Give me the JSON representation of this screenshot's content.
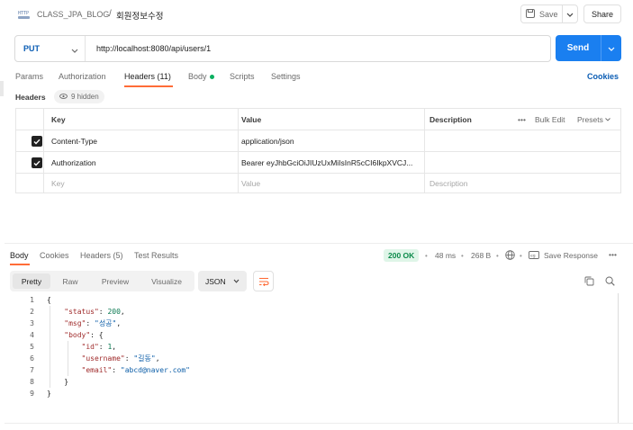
{
  "breadcrumb": {
    "collection": "CLASS_JPA_BLOG",
    "separator": "/",
    "request": "회원정보수정"
  },
  "toolbar": {
    "save_label": "Save",
    "share_label": "Share"
  },
  "request": {
    "method": "PUT",
    "url": "http://localhost:8080/api/users/1",
    "send_label": "Send"
  },
  "req_tabs": [
    {
      "label": "Params"
    },
    {
      "label": "Authorization"
    },
    {
      "label": "Headers (11)"
    },
    {
      "label": "Body"
    },
    {
      "label": "Scripts"
    },
    {
      "label": "Settings"
    }
  ],
  "cookies_label": "Cookies",
  "headers_section": {
    "title": "Headers",
    "hidden_label": "9 hidden",
    "columns": {
      "key": "Key",
      "value": "Value",
      "description": "Description",
      "bulk_edit": "Bulk Edit",
      "presets": "Presets"
    },
    "rows": [
      {
        "checked": true,
        "key": "Content-Type",
        "value": "application/json",
        "description": ""
      },
      {
        "checked": true,
        "key": "Authorization",
        "value": "Bearer eyJhbGciOiJIUzUxMiIsInR5cCI6IkpXVCJ...",
        "description": ""
      }
    ],
    "placeholder": {
      "key": "Key",
      "value": "Value",
      "description": "Description"
    }
  },
  "response": {
    "tabs": [
      {
        "label": "Body"
      },
      {
        "label": "Cookies"
      },
      {
        "label": "Headers (5)"
      },
      {
        "label": "Test Results"
      }
    ],
    "status": "200 OK",
    "time": "48 ms",
    "size": "268 B",
    "save_response_label": "Save Response",
    "views": [
      "Pretty",
      "Raw",
      "Preview",
      "Visualize"
    ],
    "active_view": "Pretty",
    "format": "JSON",
    "line_numbers": [
      "1",
      "2",
      "3",
      "4",
      "5",
      "6",
      "7",
      "8",
      "9"
    ],
    "body": {
      "status_key": "\"status\"",
      "status_val": "200",
      "msg_key": "\"msg\"",
      "msg_val": "\"성공\"",
      "body_key": "\"body\"",
      "id_key": "\"id\"",
      "id_val": "1",
      "username_key": "\"username\"",
      "username_val": "\"길동\"",
      "email_key": "\"email\"",
      "email_val": "\"abcd@naver.com\""
    }
  },
  "colors": {
    "accent": "#ff6c37",
    "send": "#1a7ff0",
    "method": "#0b5db4",
    "status_ok": "#0b8a4a"
  }
}
